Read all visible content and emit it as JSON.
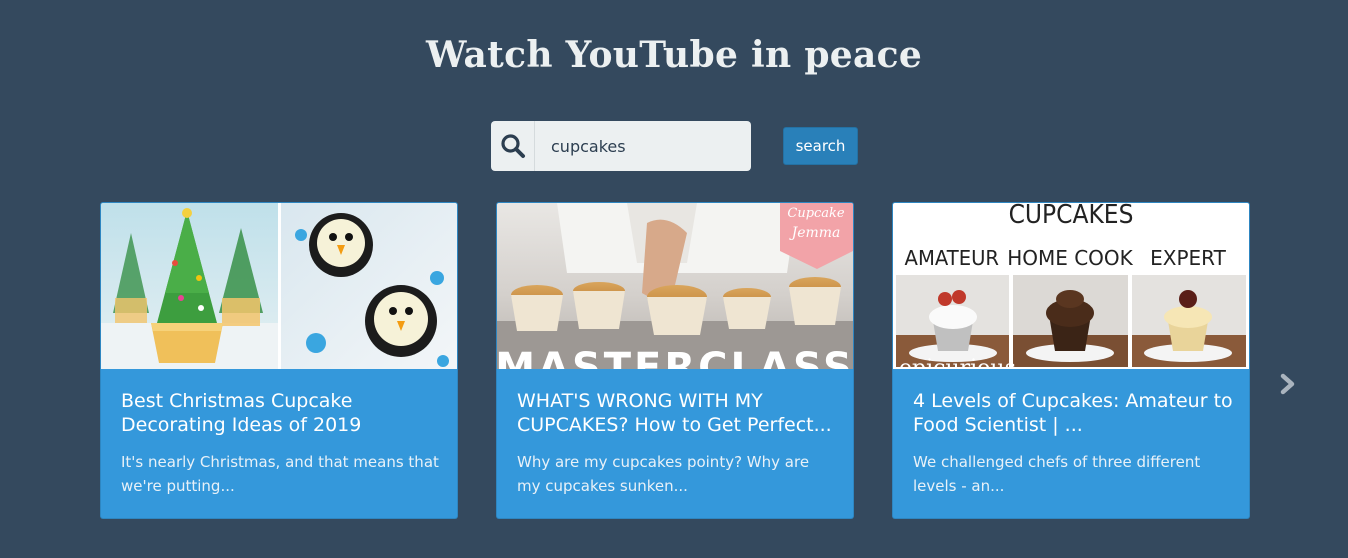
{
  "header": {
    "title": "Watch YouTube in peace"
  },
  "search": {
    "value": "cupcakes",
    "button_label": "search",
    "icon": "search-icon"
  },
  "results": [
    {
      "title": "Best Christmas Cupcake Decorating Ideas of 2019",
      "description": "It's nearly Christmas, and that means that we're putting..."
    },
    {
      "title": "WHAT'S WRONG WITH MY CUPCAKES? How to Get Perfect...",
      "description": "Why are my cupcakes pointy? Why are my cupcakes sunken...",
      "thumbnail_text": {
        "logo_line1": "Cupcake",
        "logo_line2": "Jemma",
        "banner": "MASTERCLASS"
      }
    },
    {
      "title": "4 Levels of Cupcakes: Amateur to Food Scientist | ...",
      "description": "We challenged chefs of three different levels - an...",
      "thumbnail_text": {
        "heading": "CUPCAKES",
        "col1": "AMATEUR",
        "col2": "HOME COOK",
        "col3": "EXPERT",
        "brand": "epicurious"
      }
    }
  ],
  "navigation": {
    "next_icon": "chevron-right-icon"
  },
  "colors": {
    "background": "#34495e",
    "card": "#3498db",
    "button": "#2980b9",
    "search_field": "#ecf0f1"
  }
}
